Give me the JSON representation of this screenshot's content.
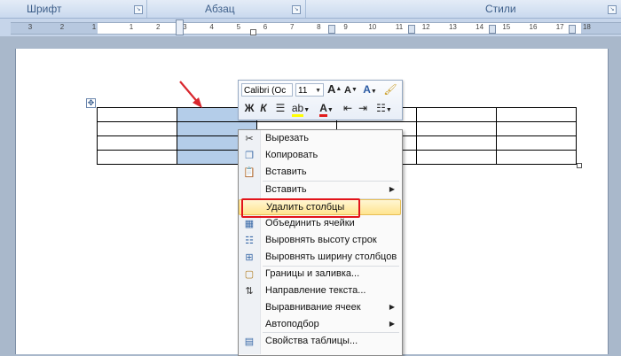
{
  "ribbon": {
    "groups": [
      {
        "label": "Шрифт"
      },
      {
        "label": "Абзац"
      },
      {
        "label": "Стили"
      }
    ]
  },
  "ruler": {
    "numbers_left": [
      "3",
      "2",
      "1"
    ],
    "numbers_right": [
      "1",
      "2",
      "3",
      "4",
      "5",
      "6",
      "7",
      "8",
      "9",
      "10",
      "11",
      "12",
      "13",
      "14",
      "15",
      "16",
      "17",
      "18"
    ]
  },
  "mini_toolbar": {
    "font_name": "Calibri (Oc",
    "font_size": "11",
    "grow_font": "A",
    "shrink_font": "A",
    "bold": "Ж",
    "italic": "К",
    "font_color_glyph": "A"
  },
  "context_menu": {
    "items": [
      {
        "label": "Вырезать",
        "icon": "scissors-icon"
      },
      {
        "label": "Копировать",
        "icon": "copy-icon"
      },
      {
        "label": "Вставить",
        "icon": "paste-icon"
      },
      {
        "label": "Вставить",
        "icon": "",
        "submenu": true
      },
      {
        "label": "Удалить столбцы",
        "icon": "",
        "highlighted": true
      },
      {
        "label": "Объединить ячейки",
        "icon": "merge-cells-icon"
      },
      {
        "label": "Выровнять высоту строк",
        "icon": "distribute-rows-icon"
      },
      {
        "label": "Выровнять ширину столбцов",
        "icon": "distribute-columns-icon"
      },
      {
        "label": "Границы и заливка...",
        "icon": "borders-icon"
      },
      {
        "label": "Направление текста...",
        "icon": "text-direction-icon"
      },
      {
        "label": "Выравнивание ячеек",
        "icon": "",
        "submenu": true
      },
      {
        "label": "Автоподбор",
        "icon": "",
        "submenu": true
      },
      {
        "label": "Свойства таблицы...",
        "icon": "table-properties-icon"
      }
    ]
  },
  "colors": {
    "selection": "#b4cde9",
    "highlight_border": "#e2141b",
    "arrow": "#d9272e"
  }
}
